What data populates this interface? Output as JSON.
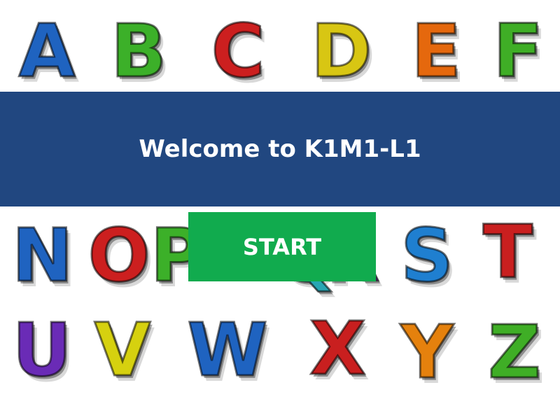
{
  "background_letters": {
    "row1": [
      {
        "char": "A",
        "color": "#1f63c0"
      },
      {
        "char": "B",
        "color": "#3cb029"
      },
      {
        "char": "C",
        "color": "#cc1f1f"
      },
      {
        "char": "D",
        "color": "#d8c613"
      },
      {
        "char": "E",
        "color": "#e5680d"
      },
      {
        "char": "F",
        "color": "#3fae26"
      }
    ],
    "row2": [
      {
        "char": "N",
        "color": "#1f63c0"
      },
      {
        "char": "O",
        "color": "#cc1f1f"
      },
      {
        "char": "P",
        "color": "#3cb029"
      },
      {
        "char": "Q",
        "color": "#27a6b3"
      },
      {
        "char": "R",
        "color": "#7b2fb0"
      },
      {
        "char": "S",
        "color": "#1f7fd0"
      },
      {
        "char": "T",
        "color": "#c91f1f"
      }
    ],
    "row3": [
      {
        "char": "U",
        "color": "#6a2bb6"
      },
      {
        "char": "V",
        "color": "#d6d10f"
      },
      {
        "char": "W",
        "color": "#1f63c0"
      },
      {
        "char": "X",
        "color": "#c91f1f"
      },
      {
        "char": "Y",
        "color": "#e5810d"
      },
      {
        "char": "Z",
        "color": "#3fae26"
      }
    ]
  },
  "banner": {
    "title": "Welcome to K1M1-L1",
    "color": "#214780"
  },
  "start_button": {
    "label": "START",
    "color": "#11ab4e"
  }
}
